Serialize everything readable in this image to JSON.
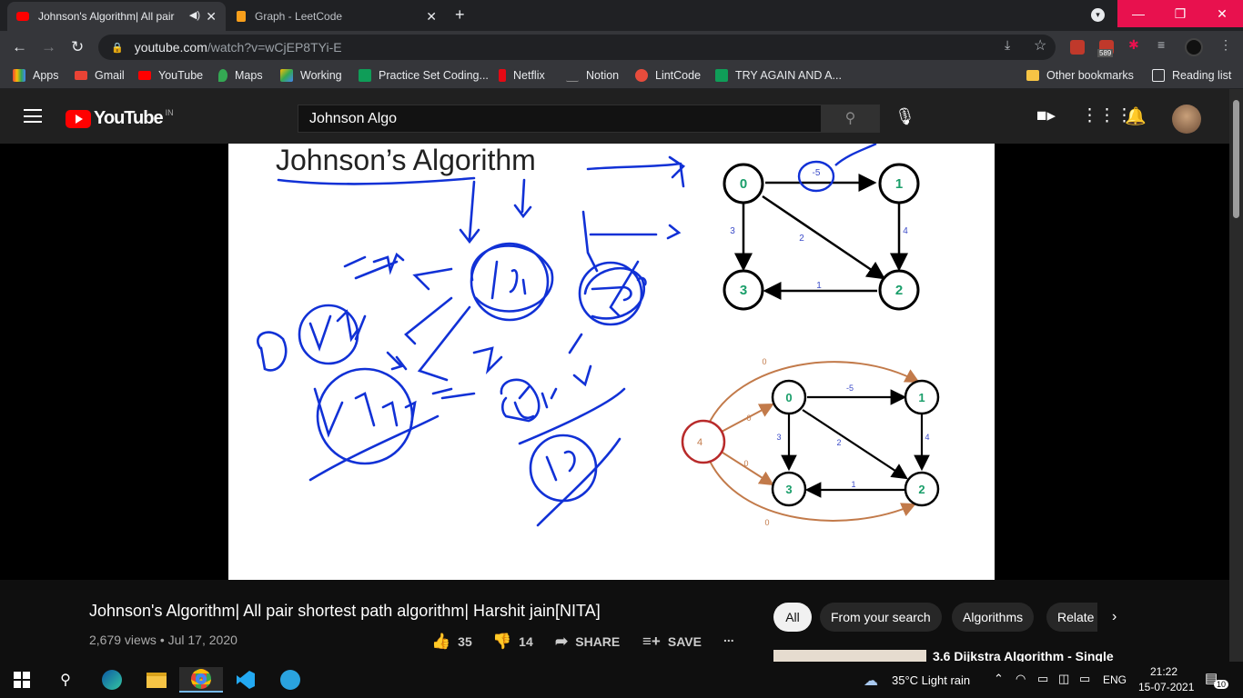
{
  "browser": {
    "tabs": [
      {
        "title": "Johnson's Algorithm| All pair"
      },
      {
        "title": "Graph - LeetCode"
      }
    ],
    "url": {
      "domain": "youtube.com",
      "path": "/watch?v=wCjEP8TYi-E"
    },
    "extension_badge": "589",
    "bookmarks": [
      {
        "label": "Apps"
      },
      {
        "label": "Gmail"
      },
      {
        "label": "YouTube"
      },
      {
        "label": "Maps"
      },
      {
        "label": "Working"
      },
      {
        "label": "Practice Set Coding..."
      },
      {
        "label": "Netflix"
      },
      {
        "label": "Notion"
      },
      {
        "label": "LintCode"
      },
      {
        "label": "TRY AGAIN AND A..."
      }
    ],
    "other_bookmarks": "Other bookmarks",
    "reading_list": "Reading list"
  },
  "youtube": {
    "logo_text": "YouTube",
    "country_code": "IN",
    "search_value": "Johnson Algo"
  },
  "video": {
    "slide_title": "Johnson’s Algorithm",
    "title": "Johnson's Algorithm| All pair shortest path algorithm| Harshit jain[NITA]",
    "meta": "2,679 views • Jul 17, 2020",
    "likes": "35",
    "dislikes": "14",
    "share": "SHARE",
    "save": "SAVE",
    "more": "..."
  },
  "graph_top": {
    "nodes": [
      "0",
      "1",
      "2",
      "3"
    ],
    "edges": [
      {
        "from": "0",
        "to": "1",
        "w": "-5"
      },
      {
        "from": "0",
        "to": "3",
        "w": "3"
      },
      {
        "from": "0",
        "to": "2",
        "w": "2"
      },
      {
        "from": "1",
        "to": "2",
        "w": "4"
      },
      {
        "from": "2",
        "to": "3",
        "w": "1"
      }
    ]
  },
  "graph_bottom": {
    "nodes": [
      "0",
      "1",
      "2",
      "3",
      "4"
    ],
    "edges": [
      {
        "from": "0",
        "to": "1",
        "w": "-5"
      },
      {
        "from": "0",
        "to": "3",
        "w": "3"
      },
      {
        "from": "0",
        "to": "2",
        "w": "2"
      },
      {
        "from": "1",
        "to": "2",
        "w": "4"
      },
      {
        "from": "2",
        "to": "3",
        "w": "1"
      },
      {
        "from": "4",
        "to": "0",
        "w": "0"
      },
      {
        "from": "4",
        "to": "1",
        "w": "0"
      },
      {
        "from": "4",
        "to": "3",
        "w": "0"
      },
      {
        "from": "4",
        "to": "2",
        "w": "0"
      }
    ]
  },
  "chips": [
    "All",
    "From your search",
    "Algorithms",
    "Relate"
  ],
  "related": {
    "title": "3.6 Dijkstra Algorithm - Single"
  },
  "taskbar": {
    "weather": "35°C  Light rain",
    "lang": "ENG",
    "time": "21:22",
    "date": "15-07-2021",
    "notifications": "10"
  }
}
